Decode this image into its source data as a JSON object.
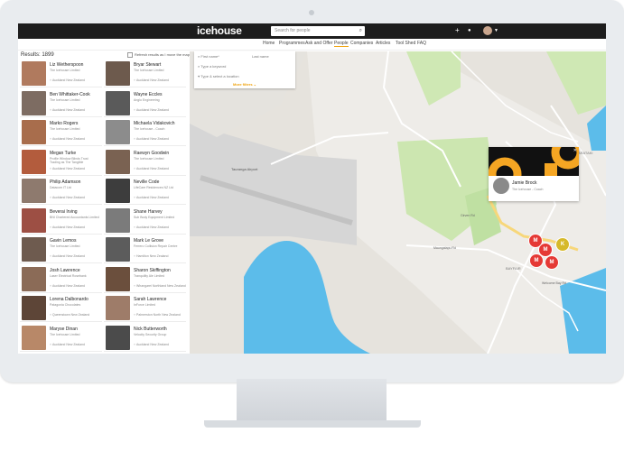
{
  "app": {
    "logo": "icehouse"
  },
  "topbar": {
    "search_placeholder": "Search for people",
    "add_icon": "+",
    "bell_icon": "🔔"
  },
  "nav": {
    "items": [
      "Home",
      "Programmes",
      "Ask and Offer",
      "People",
      "Companies",
      "Articles",
      "Tool Shed",
      "FAQ"
    ],
    "active": "People"
  },
  "results": {
    "label": "Results: 1899",
    "refresh_label": "Refresh results as I move the map"
  },
  "filter": {
    "first_name": "First name*",
    "last_name": "Last name",
    "keyword": "Type a keyword",
    "location": "Type & select a location",
    "more": "More filters"
  },
  "people": [
    {
      "name": "Liz Wetherspoon",
      "company": "The Icehouse Limited",
      "location": "Auckland New Zealand",
      "color": "#b07a5e"
    },
    {
      "name": "Bryar Stewart",
      "company": "The Icehouse Limited",
      "location": "Auckland New Zealand",
      "color": "#6d5a4d"
    },
    {
      "name": "Ben Whittaker-Cook",
      "company": "The Icehouse Limited",
      "location": "Auckland New Zealand",
      "color": "#7d6c62"
    },
    {
      "name": "Wayne Eccles",
      "company": "Anglo Engineering",
      "location": "Auckland New Zealand",
      "color": "#5a5a5a"
    },
    {
      "name": "Marko Rogers",
      "company": "The Icehouse Limited",
      "location": "Auckland New Zealand",
      "color": "#a86d4c"
    },
    {
      "name": "Michaela Vidakovich",
      "company": "The Icehouse - Coach",
      "location": "Auckland New Zealand",
      "color": "#8c8c8c"
    },
    {
      "name": "Megan Turke",
      "company": "Profile Window Blinds Trust",
      "company2": "Trading as The Tangible",
      "location": "Auckland New Zealand",
      "color": "#b35c3d"
    },
    {
      "name": "Raewyn Goodwin",
      "company": "The Icehouse Limited",
      "location": "Auckland New Zealand",
      "color": "#7a6252"
    },
    {
      "name": "Philip Adamson",
      "company": "Datacom IT Ltd",
      "location": "Auckland New Zealand",
      "color": "#8e7a6e"
    },
    {
      "name": "Neville Code",
      "company": "LifeCare Residences NZ Ltd",
      "location": "Auckland New Zealand",
      "color": "#3d3d3d"
    },
    {
      "name": "Beverai Irving",
      "company": "BNI Chartered Accountants Limited",
      "location": "Auckland New Zealand",
      "color": "#9d4f44"
    },
    {
      "name": "Shane Harvey",
      "company": "Sub Body Equipment Limited",
      "location": "Auckland New Zealand",
      "color": "#7b7b7b"
    },
    {
      "name": "Gavin Lemos",
      "company": "The Icehouse Limited",
      "location": "Auckland New Zealand",
      "color": "#6e5b4f"
    },
    {
      "name": "Mark Le Grove",
      "company": "Ferrero Collision Repair Centre",
      "location": "Hamilton New Zealand",
      "color": "#5c5c5c"
    },
    {
      "name": "Josh Lawrence",
      "company": "Laser Electrical Rosebank",
      "location": "Auckland New Zealand",
      "color": "#8b6b57"
    },
    {
      "name": "Sharon Skiffington",
      "company": "Tranquility Ale Limited",
      "location": "Whangarei Northland New Zealand",
      "color": "#6b4f3d"
    },
    {
      "name": "Lorena Dalbonardo",
      "company": "Patagonia Chocolates",
      "location": "Queenstown New Zealand",
      "color": "#5d4537"
    },
    {
      "name": "Sarah Lawrence",
      "company": "InForce Limited",
      "location": "Palmerston North New Zealand",
      "color": "#9e7c69"
    },
    {
      "name": "Maryse Dinan",
      "company": "The Icehouse Limited",
      "location": "Auckland New Zealand",
      "color": "#b88868"
    },
    {
      "name": "Nick Butterworth",
      "company": "Velocity Security Group",
      "location": "Auckland New Zealand",
      "color": "#4b4b4b"
    }
  ],
  "map": {
    "airport_label": "Tauranga Airport",
    "label_arataki": "ARATAKI",
    "label_bayfair": "BAYFAIR",
    "road_maungatapu": "Maungatapu Rd",
    "road_welcome": "Welcome Bay Rd",
    "road_girven": "Girven Rd",
    "road_sh": "Newton St"
  },
  "popup": {
    "name": "Jamie Brock",
    "company": "The Icehouse - Coach"
  },
  "markers": [
    "M",
    "M",
    "M",
    "M",
    "K"
  ]
}
